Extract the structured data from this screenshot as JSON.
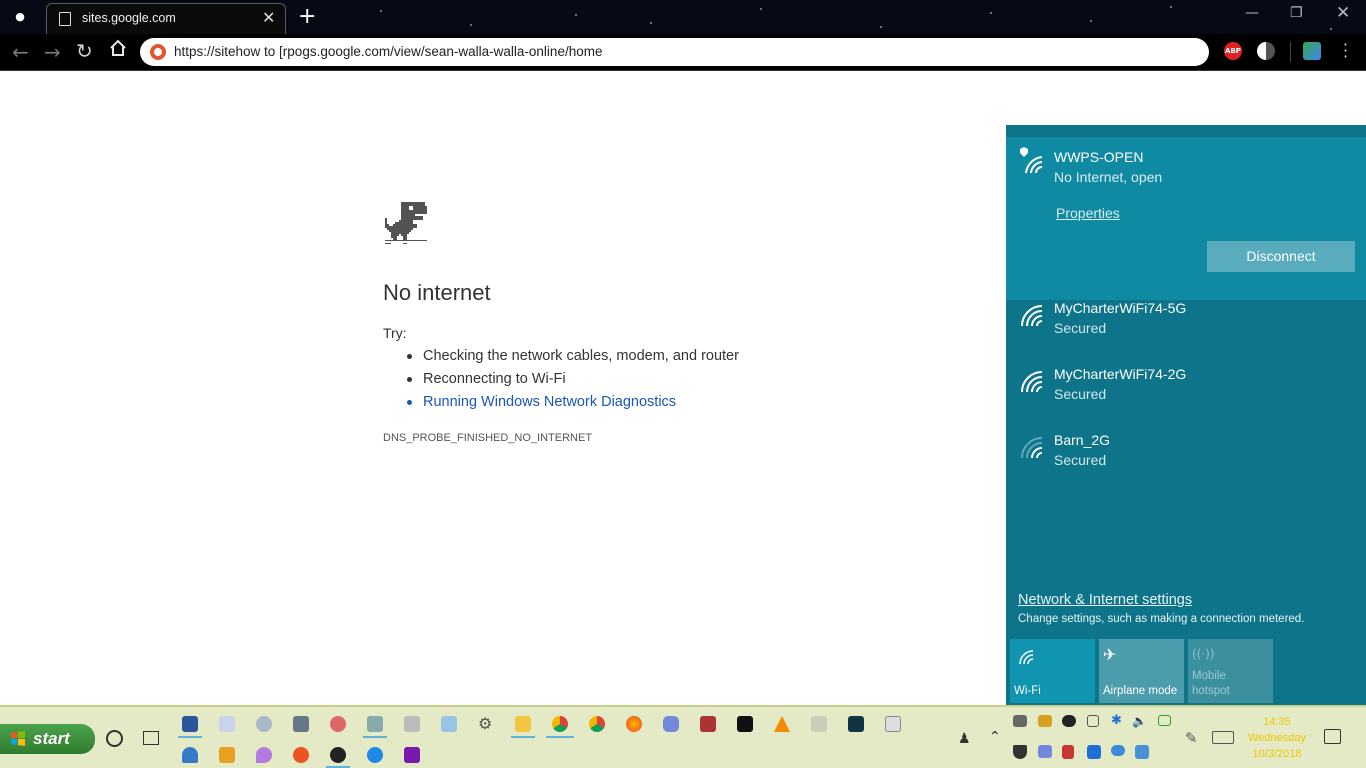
{
  "browser": {
    "tab_title": "sites.google.com",
    "url": "https://sitehow to [rpogs.google.com/view/sean-walla-walla-online/home",
    "extensions": [
      "abp-icon",
      "contrast-icon",
      "translate-icon"
    ]
  },
  "page": {
    "title": "No internet",
    "try_label": "Try:",
    "suggestions": [
      "Checking the network cables, modem, and router",
      "Reconnecting to Wi-Fi",
      "Running Windows Network Diagnostics"
    ],
    "error_code": "DNS_PROBE_FINISHED_NO_INTERNET"
  },
  "network": {
    "connected": {
      "name": "WWPS-OPEN",
      "status": "No Internet, open",
      "properties_label": "Properties",
      "disconnect_label": "Disconnect"
    },
    "others": [
      {
        "name": "MyCharterWiFi74-5G",
        "status": "Secured"
      },
      {
        "name": "MyCharterWiFi74-2G",
        "status": "Secured"
      },
      {
        "name": "Barn_2G",
        "status": "Secured"
      }
    ],
    "settings_link": "Network & Internet settings",
    "settings_sub": "Change settings, such as making a connection metered.",
    "quick_actions": {
      "wifi": "Wi-Fi",
      "airplane": "Airplane mode",
      "hotspot_line1": "Mobile",
      "hotspot_line2": "hotspot"
    }
  },
  "taskbar": {
    "start_label": "start",
    "time": "14:35",
    "day": "Wednesday",
    "date": "10/3/2018"
  },
  "colors": {
    "flyout_bg": "#0d7489",
    "connected_bg": "#0f8aa2",
    "active_tile": "#1095b0",
    "start_green": "#2f7d2f",
    "taskbar_bg": "#e4e9c6",
    "link_blue": "#1a55b8"
  }
}
